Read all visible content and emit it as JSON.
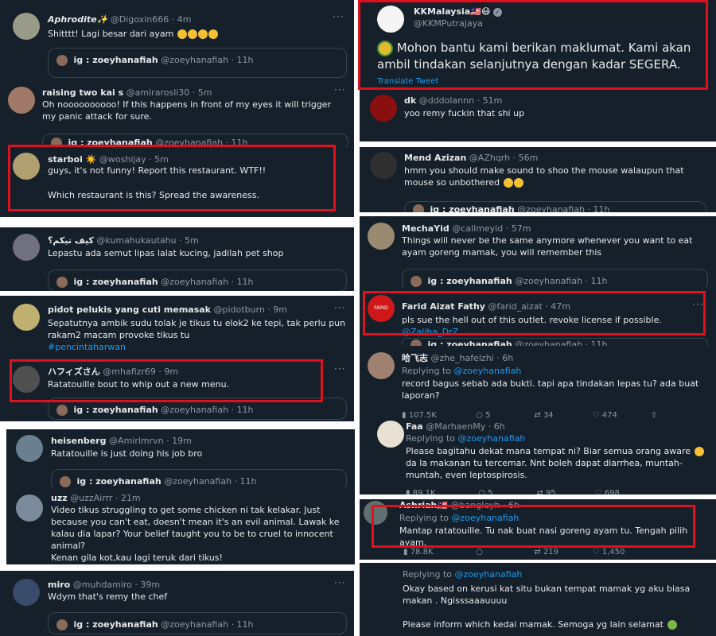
{
  "left": [
    {
      "name": "𝘼𝙥𝙝𝙧𝙤𝙙𝙞𝙩𝙚✨",
      "handle": "@Digoxin666 · 4m",
      "text": "Shitttt! Lagi besar dari ayam",
      "quote_name": "ig : zoeyhanafiah",
      "quote_handle": "@zoeyhanafiah · 11h"
    },
    {
      "name": "raising two kai s",
      "handle": "@amirarosli30 · 5m",
      "text": "Oh noooooooooo! If this happens in front of my eyes it will trigger my panic attack for sure.",
      "quote_name": "ig : zoeyhanafiah",
      "quote_handle": "@zoeyhanafiah · 11h"
    },
    {
      "name": "starboi ☀️",
      "handle": "@woshijay · 5m",
      "text": "guys, it's not funny! Report this restaurant. WTF!!",
      "text2": "Which restaurant is this? Spread the awareness."
    },
    {
      "name": "كيف تيكم؟",
      "handle": "@kumahukautahu · 5m",
      "text": "Lepastu ada semut lipas lalat kucing, jadilah pet shop",
      "quote_name": "ig : zoeyhanafiah",
      "quote_handle": "@zoeyhanafiah · 11h"
    },
    {
      "name": "pidot pelukis yang cuti memasak",
      "handle": "@pidotburn · 9m",
      "text": "Sepatutnya ambik sudu tolak je tikus tu elok2 ke tepi, tak perlu pun rakam2 macam provoke tikus tu",
      "hashtag": "#pencintaharwan"
    },
    {
      "name": "ハフィズさん",
      "handle": "@mhafizr69 · 9m",
      "text": "Ratatouille bout to whip out a new menu.",
      "quote_name": "ig : zoeyhanafiah",
      "quote_handle": "@zoeyhanafiah · 11h"
    },
    {
      "name": "heisenberg",
      "handle": "@Amirlmrvn · 19m",
      "text": "Ratatouille is just doing his job bro",
      "quote_name": "ig : zoeyhanafiah",
      "quote_handle": "@zoeyhanafiah · 11h"
    },
    {
      "name": "uzz",
      "handle": "@uzzAirrr · 21m",
      "text": "Video tikus struggling to get some chicken ni tak kelakar. Just because you can't eat, doesn't mean it's an evil animal. Lawak ke kalau dia lapar? Your belief taught you to be to cruel to innocent animal?",
      "text2": "Kenan gila kot,kau lagi teruk dari tikus!"
    },
    {
      "name": "miro",
      "handle": "@muhdamiro · 39m",
      "text": "Wdym that's remy the chef",
      "quote_name": "ig : zoeyhanafiah",
      "quote_handle": "@zoeyhanafiah · 11h"
    }
  ],
  "right": [
    {
      "name": "KKMalaysia🇲🇾😷",
      "handle": "@KKMPutrajaya",
      "text": "Mohon bantu kami berikan maklumat. Kami akan ambil tindakan selanjutnya dengan kadar SEGERA.",
      "translate": "Translate Tweet"
    },
    {
      "name": "dk",
      "handle": "@dddolannn · 51m",
      "text": "yoo remy fuckin that shi up"
    },
    {
      "name": "Mend Azizan",
      "handle": "@AZhqrh · 56m",
      "text": "hmm you should make sound to shoo the mouse walaupun that mouse so unbothered",
      "quote_name": "ig : zoeyhanafiah",
      "quote_handle": "@zoeyhanafiah · 11h"
    },
    {
      "name": "MechaYid",
      "handle": "@callmeyid · 57m",
      "text": "Things will never be the same anymore whenever you want to eat ayam goreng mamak, you will remember this",
      "quote_name": "ig : zoeyhanafiah",
      "quote_handle": "@zoeyhanafiah · 11h"
    },
    {
      "name": "Farid Aizat Fathy",
      "handle": "@farid_aizat · 47m",
      "text": "pls sue the hell out of this outlet. revoke license if possible.",
      "mention": "@Zaliha_DrZ",
      "avatar_label": "FARID",
      "quote_name": "ig : zoeyhanafiah",
      "quote_handle": "@zoeyhanafiah · 11h"
    },
    {
      "name": "哈飞志",
      "handle": "@zhe_hafelzhi · 6h",
      "reply_prefix": "Replying to",
      "reply_to": "@zoeyhanafiah",
      "text": "record bagus sebab ada bukti. tapi apa tindakan lepas tu? ada buat laporan?",
      "metrics": [
        "107.5K",
        "5",
        "34",
        "474"
      ]
    },
    {
      "name": "Faa",
      "handle": "@MarhaenMy · 6h",
      "reply_prefix": "Replying to",
      "reply_to": "@zoeyhanafiah",
      "text": "Please bagitahu dekat mana tempat ni? Biar semua orang aware",
      "text_b": "da la makanan tu tercemar. Nnt boleh dapat diarrhea, muntah-muntah, even leptospirosis.",
      "metrics": [
        "89.1K",
        "5",
        "95",
        "698"
      ]
    },
    {
      "name": "Ashriah🇲🇾",
      "handle": "@bangleyh · 6h",
      "reply_prefix": "Replying to",
      "reply_to": "@zoeyhanafiah",
      "text": "Mantap ratatouille. Tu nak buat nasi goreng ayam tu. Tengah pilih ayam.",
      "metrics": [
        "78.8K",
        "",
        "219",
        "1,450"
      ]
    },
    {
      "reply_prefix": "Replying to",
      "reply_to": "@zoeyhanafiah",
      "text": "Okay based on kerusi kat situ bukan tempat mamak yg aku biasa makan . Ngisssaaauuuu",
      "text2": "Please inform which kedai mamak. Semoga yg lain selamat"
    }
  ],
  "colors": {
    "background": "#15202b",
    "highlight_box": "#e0101c",
    "link": "#1d9bf0",
    "muted": "#8b98a5"
  }
}
